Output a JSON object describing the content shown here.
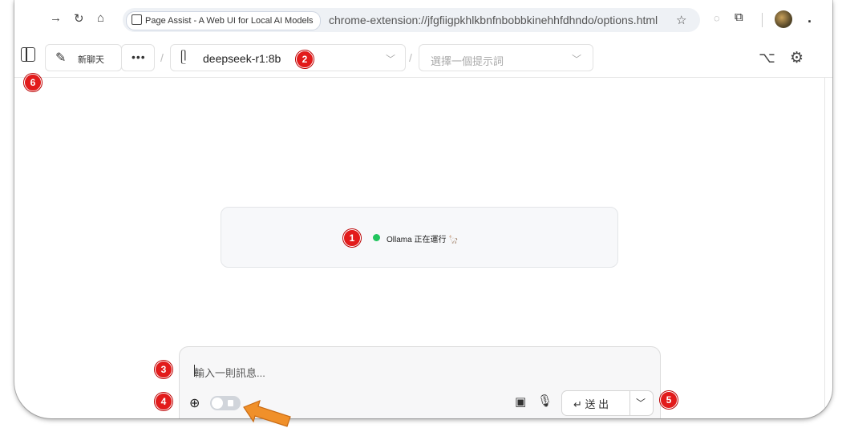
{
  "browser": {
    "page_chip": "Page Assist - A Web UI for Local AI Models",
    "url": "chrome-extension://jfgfiigpkhlkbnfnbobbkinehhfdhndo/options.html",
    "more_label": "."
  },
  "toolbar": {
    "new_chat_label": "新聊天",
    "more_label": "•••",
    "model_name": "deepseek-r1:8b",
    "prompt_placeholder": "選擇一個提示詞",
    "slash": "/"
  },
  "status": {
    "text": "Ollama 正在運行 🦙",
    "dot_color": "#22c55e"
  },
  "composer": {
    "placeholder": "輸入一則訊息...",
    "send_label": "送 出",
    "web_search_enabled": false
  },
  "badges": {
    "b1": "1",
    "b2": "2",
    "b3": "3",
    "b4": "4",
    "b5": "5",
    "b6": "6"
  },
  "accent": {
    "badge": "#e21b1b",
    "arrow": "#f0902a"
  }
}
